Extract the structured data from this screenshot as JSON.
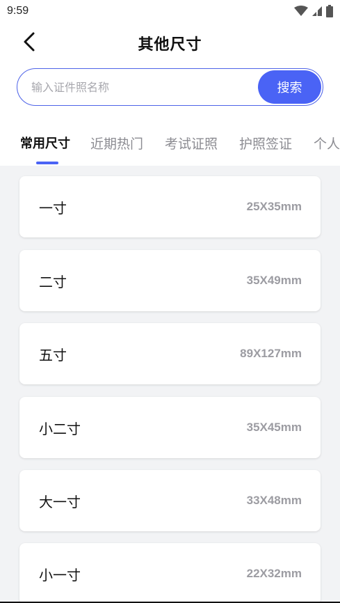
{
  "status_bar": {
    "time": "9:59"
  },
  "header": {
    "title": "其他尺寸"
  },
  "search": {
    "placeholder": "输入证件照名称",
    "value": "",
    "button_label": "搜索"
  },
  "tabs": [
    {
      "label": "常用尺寸",
      "active": true
    },
    {
      "label": "近期热门",
      "active": false
    },
    {
      "label": "考试证照",
      "active": false
    },
    {
      "label": "护照签证",
      "active": false
    },
    {
      "label": "个人",
      "active": false
    }
  ],
  "sizes": [
    {
      "name": "一寸",
      "size": "25X35mm"
    },
    {
      "name": "二寸",
      "size": "35X49mm"
    },
    {
      "name": "五寸",
      "size": "89X127mm"
    },
    {
      "name": "小二寸",
      "size": "35X45mm"
    },
    {
      "name": "大一寸",
      "size": "33X48mm"
    },
    {
      "name": "小一寸",
      "size": "22X32mm"
    }
  ],
  "colors": {
    "accent": "#4a63f5",
    "list_bg": "#f2f3f5",
    "muted_text": "#9c9ca2"
  },
  "icons": {
    "back": "chevron-left-icon",
    "wifi": "wifi-icon",
    "signal": "signal-icon",
    "battery": "battery-icon"
  }
}
